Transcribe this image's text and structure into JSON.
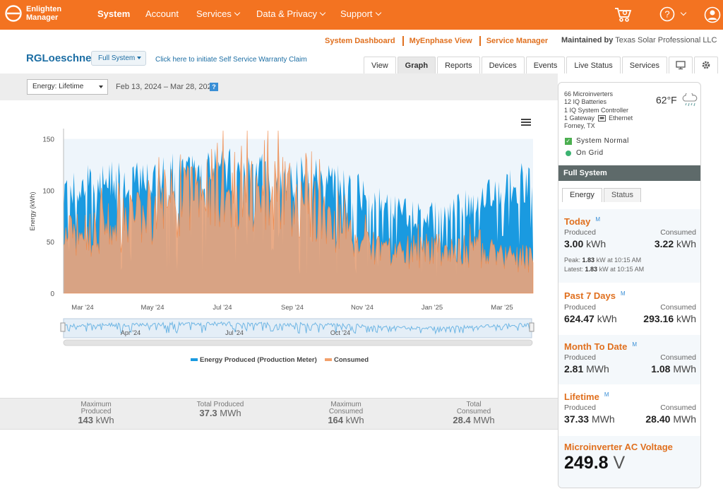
{
  "app": {
    "logo_line1": "Enlighten",
    "logo_line2": "Manager"
  },
  "nav": {
    "items": [
      {
        "label": "System",
        "active": true,
        "dropdown": false
      },
      {
        "label": "Account",
        "active": false,
        "dropdown": false
      },
      {
        "label": "Services",
        "active": false,
        "dropdown": true
      },
      {
        "label": "Data & Privacy",
        "active": false,
        "dropdown": true
      },
      {
        "label": "Support",
        "active": false,
        "dropdown": true
      }
    ],
    "icons": [
      "cart-icon",
      "help-icon",
      "user-icon"
    ]
  },
  "top_links": [
    "System Dashboard",
    "MyEnphase View",
    "Service Manager"
  ],
  "maintained": {
    "prefix": "Maintained by",
    "company": "Texas Solar Professional LLC"
  },
  "site": {
    "name": "RGLoeschner",
    "system_select": "Full System",
    "warranty_link": "Click here to initiate Self Service Warranty Claim"
  },
  "tabs": [
    "View",
    "Graph",
    "Reports",
    "Devices",
    "Events",
    "Live Status",
    "Services"
  ],
  "active_tab": "Graph",
  "tab_icons": [
    "monitor-icon",
    "gear-icon"
  ],
  "filter": {
    "energy_select": "Energy: Lifetime",
    "date_range": "Feb 13, 2024 – Mar 28, 2025",
    "help": "?"
  },
  "chart_data": {
    "type": "area",
    "ylabel": "Energy (kWh)",
    "yticks": [
      0,
      50,
      100,
      150
    ],
    "ylim": [
      0,
      160
    ],
    "xticks": [
      "Mar '24",
      "May '24",
      "Jul '24",
      "Sep '24",
      "Nov '24",
      "Jan '25",
      "Mar '25"
    ],
    "navigator_ticks": [
      "Apr '24",
      "Jul '24",
      "Oct '24"
    ],
    "legend_position": "bottom",
    "series": [
      {
        "name": "Energy Produced (Production Meter)",
        "color": "#1a9ae0"
      },
      {
        "name": "Consumed",
        "color": "#f2a06b"
      }
    ],
    "monthly_approx": [
      {
        "month": "Feb '24",
        "produced": 105,
        "consumed": 60
      },
      {
        "month": "Mar '24",
        "produced": 118,
        "consumed": 65
      },
      {
        "month": "Apr '24",
        "produced": 120,
        "consumed": 75
      },
      {
        "month": "May '24",
        "produced": 125,
        "consumed": 95
      },
      {
        "month": "Jun '24",
        "produced": 130,
        "consumed": 115
      },
      {
        "month": "Jul '24",
        "produced": 128,
        "consumed": 110
      },
      {
        "month": "Aug '24",
        "produced": 125,
        "consumed": 105
      },
      {
        "month": "Sep '24",
        "produced": 120,
        "consumed": 85
      },
      {
        "month": "Oct '24",
        "produced": 110,
        "consumed": 60
      },
      {
        "month": "Nov '24",
        "produced": 90,
        "consumed": 40
      },
      {
        "month": "Dec '24",
        "produced": 80,
        "consumed": 45
      },
      {
        "month": "Jan '25",
        "produced": 90,
        "consumed": 45
      },
      {
        "month": "Feb '25",
        "produced": 105,
        "consumed": 40
      },
      {
        "month": "Mar '25",
        "produced": 120,
        "consumed": 35
      }
    ]
  },
  "summary": [
    {
      "label1": "Maximum",
      "label2": "Produced",
      "value": "143",
      "unit": "kWh"
    },
    {
      "label1": "",
      "label2": "Total Produced",
      "value": "37.3",
      "unit": "MWh"
    },
    {
      "label1": "Maximum",
      "label2": "Consumed",
      "value": "164",
      "unit": "kWh"
    },
    {
      "label1": "Total",
      "label2": "Consumed",
      "value": "28.4",
      "unit": "MWh"
    }
  ],
  "panel": {
    "info_lines": [
      "66 Microinverters",
      "12 IQ Batteries",
      "1 IQ System Controller",
      "1 Gateway",
      "Forney, TX"
    ],
    "gateway_conn": "Ethernet",
    "temperature": "62°F",
    "status_normal": "System Normal",
    "status_grid": "On Grid",
    "section_title": "Full System",
    "tabs": [
      "Energy",
      "Status"
    ],
    "m": "M",
    "produced_label": "Produced",
    "consumed_label": "Consumed",
    "today": {
      "title": "Today",
      "produced": "3.00",
      "produced_unit": "kWh",
      "consumed": "3.22",
      "consumed_unit": "kWh",
      "peak_label": "Peak:",
      "peak_value": "1.83",
      "peak_rest": "kW at 10:15 AM",
      "latest_label": "Latest:",
      "latest_value": "1.83",
      "latest_rest": "kW at 10:15 AM"
    },
    "past7": {
      "title": "Past 7 Days",
      "produced": "624.47",
      "produced_unit": "kWh",
      "consumed": "293.16",
      "consumed_unit": "kWh"
    },
    "mtd": {
      "title": "Month To Date",
      "produced": "2.81",
      "produced_unit": "MWh",
      "consumed": "1.08",
      "consumed_unit": "MWh"
    },
    "lifetime": {
      "title": "Lifetime",
      "produced": "37.33",
      "produced_unit": "MWh",
      "consumed": "28.40",
      "consumed_unit": "MWh"
    },
    "voltage": {
      "title": "Microinverter AC Voltage",
      "value": "249.8",
      "unit": "V"
    }
  },
  "colors": {
    "brand": "#f37321",
    "accent_orange": "#e0701f",
    "link_blue": "#1c6ea4",
    "produced": "#1a9ae0",
    "consumed": "#f2a06b"
  }
}
